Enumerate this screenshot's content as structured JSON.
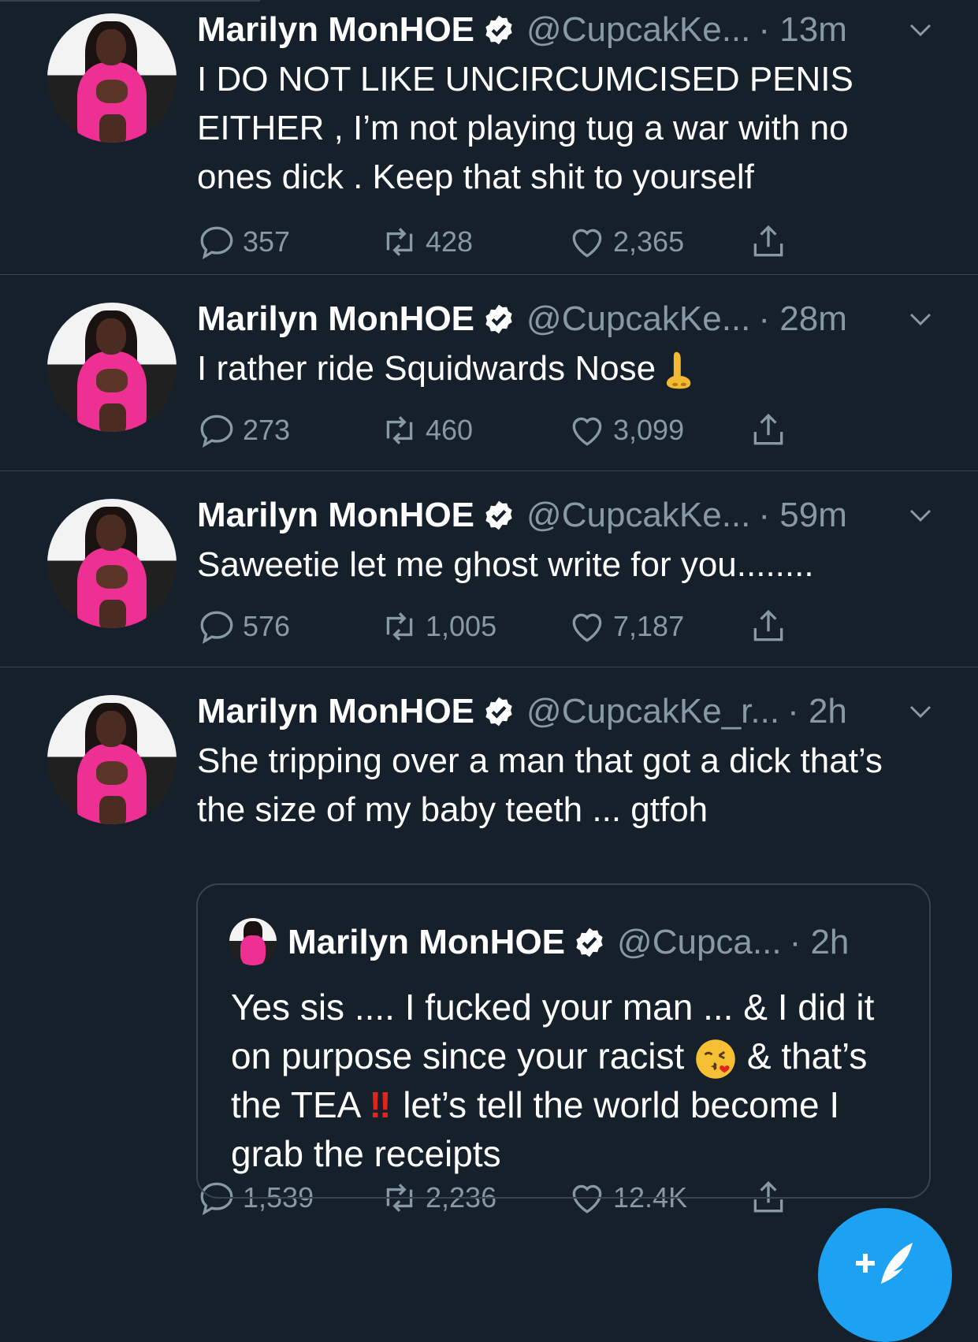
{
  "tweets": [
    {
      "name": "Marilyn MonHOE",
      "handle": "@CupcakKe...",
      "time": "· 13m",
      "text": "I DO NOT LIKE UNCIRCUMCISED PENIS EITHER , I’m not playing tug a war with no ones dick . Keep that shit to yourself",
      "replies": "357",
      "retweets": "428",
      "likes": "2,365"
    },
    {
      "name": "Marilyn MonHOE",
      "handle": "@CupcakKe...",
      "time": "· 28m",
      "text": "I rather ride Squidwards Nose",
      "emoji": "nose",
      "replies": "273",
      "retweets": "460",
      "likes": "3,099"
    },
    {
      "name": "Marilyn MonHOE",
      "handle": "@CupcakKe...",
      "time": "· 59m",
      "text": "Saweetie let me ghost write for you........",
      "replies": "576",
      "retweets": "1,005",
      "likes": "7,187"
    },
    {
      "name": "Marilyn MonHOE",
      "handle": "@CupcakKe_r...",
      "time": "· 2h",
      "text": "She tripping over a man that got a dick that’s the size of my baby teeth ... gtfoh",
      "replies": "1,539",
      "retweets": "2,236",
      "likes": "12.4K",
      "quote": {
        "name": "Marilyn MonHOE",
        "handle": "@Cupca...",
        "time": "· 2h",
        "text_part1": "Yes sis .... I fucked your man ... & I did it on purpose since your racist",
        "emoji_kiss": "kiss-face",
        "text_part2": "& that’s the TEA",
        "emoji_bang": "‼",
        "text_part3": "let’s tell the world become I grab the receipts"
      }
    }
  ],
  "colors": {
    "background": "#15202b",
    "secondary_text": "#8899a6",
    "divider": "#38444d",
    "accent": "#1da1f2"
  },
  "icons": [
    "reply-icon",
    "retweet-icon",
    "like-icon",
    "share-icon",
    "verified-badge-icon",
    "caret-down-icon",
    "compose-tweet-icon"
  ]
}
